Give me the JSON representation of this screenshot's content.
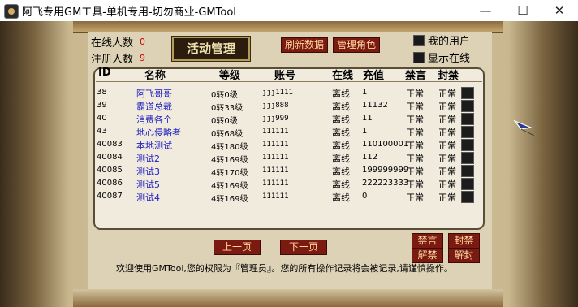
{
  "window": {
    "title": "阿飞专用GM工具-单机专用-切勿商业-GMTool",
    "min_glyph": "—",
    "max_glyph": "☐",
    "close_glyph": "✕"
  },
  "stats": {
    "online_label": "在线人数",
    "online_count": "0",
    "registered_label": "注册人数",
    "registered_count": "9"
  },
  "toolbar": {
    "activity_label": "活动管理",
    "refresh_label": "刷新数据",
    "manage_role_label": "管理角色"
  },
  "filters": {
    "my_users_label": "我的用户",
    "show_online_label": "显示在线"
  },
  "table": {
    "headers": [
      "ID",
      "名称",
      "等级",
      "账号",
      "在线",
      "充值",
      "禁言",
      "封禁"
    ],
    "rows": [
      {
        "id": "38",
        "name": "阿飞哥哥",
        "level": "0转0级",
        "account": "jjj1111",
        "online": "离线",
        "recharge": "1",
        "mute": "正常",
        "ban": "正常"
      },
      {
        "id": "39",
        "name": "霸道总裁",
        "level": "0转33级",
        "account": "jjj888",
        "online": "离线",
        "recharge": "11132",
        "mute": "正常",
        "ban": "正常"
      },
      {
        "id": "40",
        "name": "消费各个",
        "level": "0转0级",
        "account": "jjj999",
        "online": "离线",
        "recharge": "11",
        "mute": "正常",
        "ban": "正常"
      },
      {
        "id": "43",
        "name": "地心侵略者",
        "level": "0转68级",
        "account": "111111",
        "online": "离线",
        "recharge": "1",
        "mute": "正常",
        "ban": "正常"
      },
      {
        "id": "40083",
        "name": "本地测试",
        "level": "4转180级",
        "account": "111111",
        "online": "离线",
        "recharge": "110100001",
        "mute": "正常",
        "ban": "正常"
      },
      {
        "id": "40084",
        "name": "测试2",
        "level": "4转169级",
        "account": "111111",
        "online": "离线",
        "recharge": "112",
        "mute": "正常",
        "ban": "正常"
      },
      {
        "id": "40085",
        "name": "测试3",
        "level": "4转170级",
        "account": "111111",
        "online": "离线",
        "recharge": "199999999",
        "mute": "正常",
        "ban": "正常"
      },
      {
        "id": "40086",
        "name": "测试5",
        "level": "4转169级",
        "account": "111111",
        "online": "离线",
        "recharge": "222223333",
        "mute": "正常",
        "ban": "正常"
      },
      {
        "id": "40087",
        "name": "测试4",
        "level": "4转169级",
        "account": "111111",
        "online": "离线",
        "recharge": "0",
        "mute": "正常",
        "ban": "正常"
      }
    ]
  },
  "pager": {
    "prev_label": "上一页",
    "next_label": "下一页"
  },
  "actions": {
    "mute_label": "禁言",
    "ban_label": "封禁",
    "unmute_label": "解禁",
    "unban_label": "解封"
  },
  "footer": {
    "message": "欢迎使用GMTool,您的权限为『管理员』。您的所有操作记录将会被记录,请谨慎操作。"
  },
  "icons": [
    "app-icon",
    "checkbox-icon",
    "row-select-icon",
    "feather-cursor-icon"
  ]
}
